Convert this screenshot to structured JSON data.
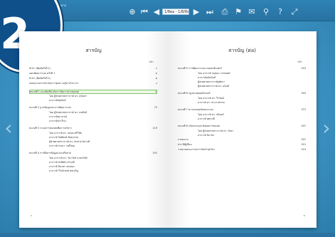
{
  "toolbar": {
    "title_line1": "ระบบอินเทอร์เน็ตและเครือข่าย",
    "title_line2": "อิเล็กทรอนิกส์",
    "page_field": "1/8ea - 1/8/8a/36",
    "icons": [
      "zoom-in-icon",
      "first-page-icon",
      "prev-page-icon",
      "next-page-icon",
      "last-page-icon",
      "print-icon",
      "bookmark-icon",
      "email-icon",
      "search-icon",
      "help-icon",
      "fullscreen-icon"
    ]
  },
  "badge": {
    "number": "2"
  },
  "left_page": {
    "heading": "สารบัญ",
    "column_label": "หน้า",
    "entries": [
      {
        "text": "คำนำ (พิมพ์ครั้งที่ 1)",
        "page": "ก",
        "kind": "item"
      },
      {
        "text": "แผนพัฒนาระบบ ครั้งที่ 1",
        "page": "ข",
        "kind": "item"
      },
      {
        "text": "คำนำ (พิมพ์ครั้งที่ 2)",
        "page": "ค",
        "kind": "item"
      },
      {
        "text": "บทสรุป ผลการดำเนินการชุดความรู้ทางวิชาการ",
        "page": "ง",
        "kind": "item"
      },
      {
        "text": "หนวยที่ 1 แนวคิดเกี่ยวกับการจัดการสารสนเทศ",
        "page": "1",
        "kind": "chapter",
        "highlight": true
      },
      {
        "text": "โดย ผู้ช่วยศาสตราจารย์ ดร. สุนันทา",
        "page": "",
        "kind": "sub"
      },
      {
        "text": "อาจารย์ณัฐนันท์",
        "page": "",
        "kind": "sub"
      },
      {
        "text": "หนวยที่ 2 ฐานข้อมูลและการพัฒนาระบบ",
        "page": "73",
        "kind": "chapter"
      },
      {
        "text": "โดย ผู้ช่วยศาสตราจารย์ ดร. สมศักดิ์",
        "page": "",
        "kind": "sub"
      },
      {
        "text": "อาจารย์สุภาภรณ์",
        "page": "",
        "kind": "sub"
      },
      {
        "text": "อาจารย์ประวีณา",
        "page": "",
        "kind": "sub"
      },
      {
        "text": "หนวยที่ 3 ระบบสารสนเทศเพื่อการบริหาร",
        "page": "119",
        "kind": "chapter"
      },
      {
        "text": "โดย อาจารย์ ดร. ธนพล ศรีวิชัย",
        "page": "",
        "kind": "sub"
      },
      {
        "text": "อาจารย์ กิตติพงษ์ ชัยสุวรรณ",
        "page": "",
        "kind": "sub"
      },
      {
        "text": "ผู้ช่วยศาสตราจารย์ ดร. สมชาย นิลวงศ์",
        "page": "",
        "kind": "sub"
      },
      {
        "text": "อาจารย์วรรณา วงศ์ใหญ่",
        "page": "",
        "kind": "sub"
      },
      {
        "text": "หนวยที่ 4 การสื่อสารข้อมูลและเครือข่าย",
        "page": "191",
        "kind": "chapter"
      },
      {
        "text": "โดย อาจารย์ ดร. วิลาวัลย์ นาคสวัสดิ์",
        "page": "",
        "kind": "sub"
      },
      {
        "text": "อาจารย์ พรทิพย์ แก้วมณี",
        "page": "",
        "kind": "sub"
      },
      {
        "text": "อาจารย์ ปิยะพร แสงทอง",
        "page": "",
        "kind": "sub"
      },
      {
        "text": "อาจารย์ วิไลลักษณ์ สุขเจริญ",
        "page": "",
        "kind": "sub"
      }
    ],
    "page_number": "ก"
  },
  "right_page": {
    "heading": "สารบัญ (ต่อ)",
    "column_label": "หน้า",
    "entries": [
      {
        "text": "หนวยที่ 5 การพัฒนาระบบงานคอมพิวเตอร์",
        "page": "253",
        "kind": "chapter"
      },
      {
        "text": "โดย อาจารย์ กฤษณะ ปาณพงษ์",
        "page": "",
        "kind": "sub"
      },
      {
        "text": "อาจารย์มนัสนันท์",
        "page": "",
        "kind": "sub"
      },
      {
        "text": "ผู้ช่วยศาสตราจารย์สุพัตรา",
        "page": "",
        "kind": "sub"
      },
      {
        "text": "ผู้ช่วยศาสตราจารย์ ดร. อนันต์",
        "page": "",
        "kind": "sub"
      },
      {
        "text": "หนวยที่ 6 กฎหมายคอมพิวเตอร์",
        "page": "303",
        "kind": "chapter"
      },
      {
        "text": "โดย อาจารย์ ดร. วีรวัฒน์",
        "page": "",
        "kind": "sub"
      },
      {
        "text": "อาจารย์ ดร. ประภาพรรณ",
        "page": "",
        "kind": "sub"
      },
      {
        "text": "หนวยที่ 7 ความปลอดภัยของระบบ",
        "page": "373",
        "kind": "chapter"
      },
      {
        "text": "โดย อาจารย์ ดร. ชนินทร์",
        "page": "",
        "kind": "sub"
      },
      {
        "text": "อาจารย์ สุพรรณี",
        "page": "",
        "kind": "sub"
      },
      {
        "text": "หนวยที่ 8 จริยธรรมและสังคมสารสนเทศ",
        "page": "437",
        "kind": "chapter"
      },
      {
        "text": "โดย ผู้ช่วยศาสตราจารย์ ดร. วิทยา",
        "page": "",
        "kind": "sub"
      },
      {
        "text": "อาจารย์ นิภาพร",
        "page": "",
        "kind": "sub"
      },
      {
        "text": "ภาคผนวก",
        "page": "507",
        "kind": "item"
      },
      {
        "text": "ประวัติผู้เขียน",
        "page": "515",
        "kind": "item"
      },
      {
        "text": "รายนามคณะกรรมการจัดทำชุดวิชา",
        "page": "519",
        "kind": "item"
      }
    ],
    "page_number": "ข"
  },
  "colors": {
    "background": "#3e93c2",
    "toolbar": "#2f83b5",
    "badge": "#0f4f8a",
    "highlight_border": "#7cc468",
    "highlight_fill": "#eef8e6"
  }
}
